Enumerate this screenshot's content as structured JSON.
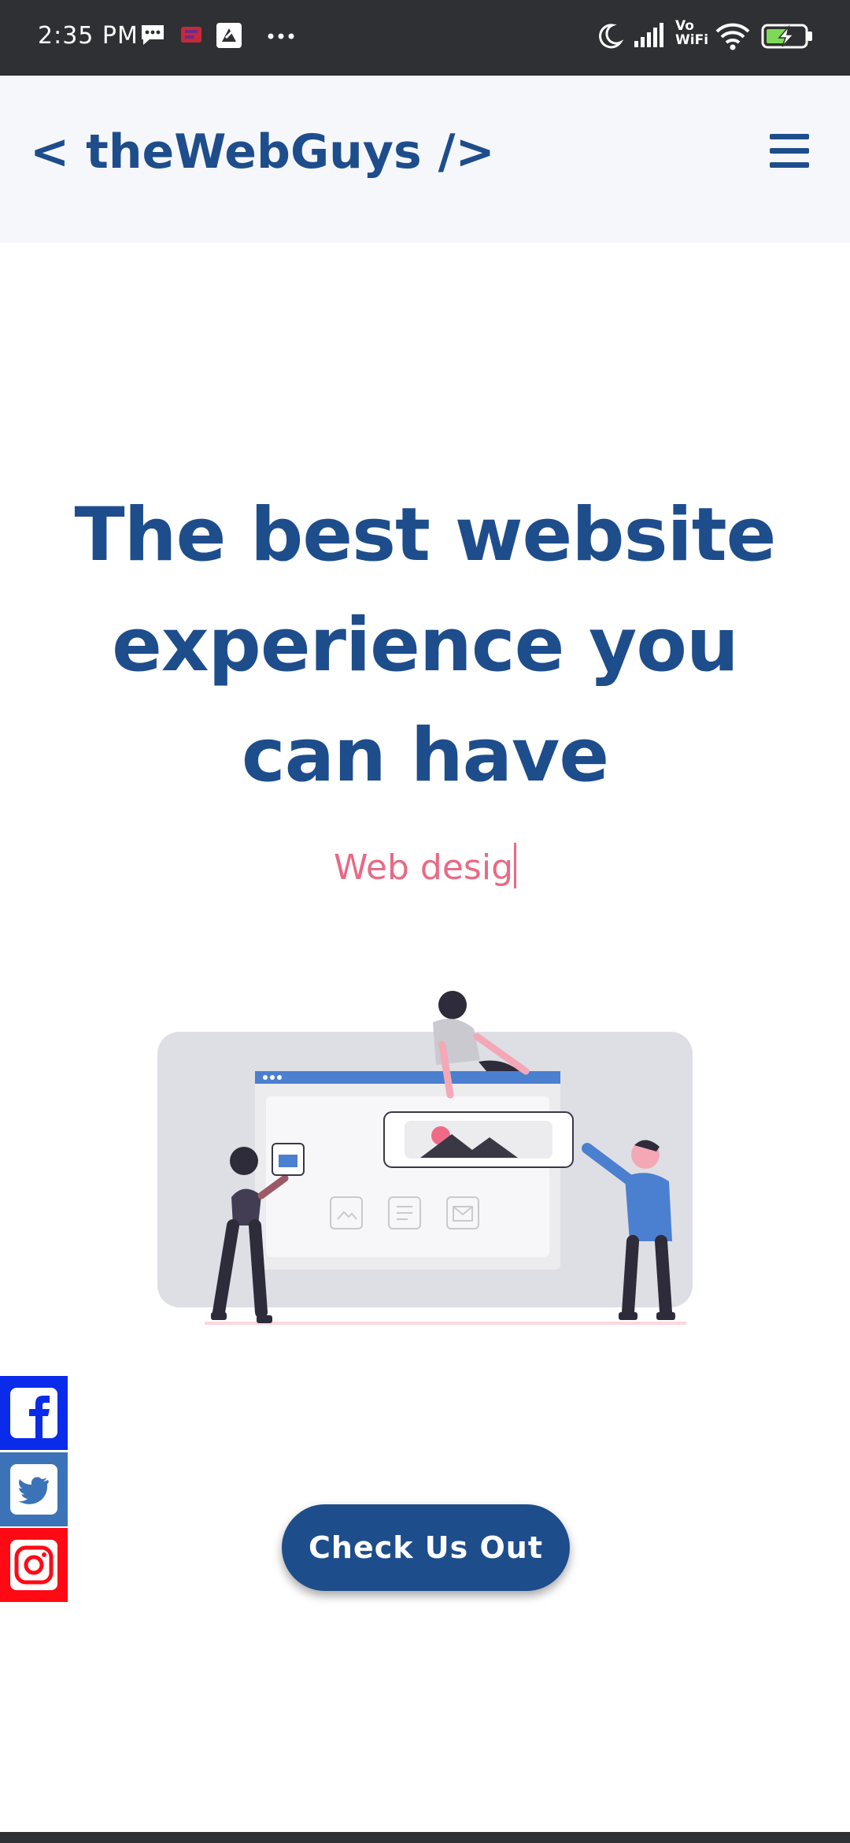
{
  "status_bar": {
    "time": "2:35 PM",
    "icons": [
      "message-icon",
      "notification-icon",
      "notification-icon",
      "more-icon",
      "moon-icon",
      "signal-icon",
      "vowifi-icon",
      "wifi-icon",
      "battery-charging-icon"
    ],
    "vowifi_label_top": "Vo",
    "vowifi_label_bottom": "WiFi"
  },
  "header": {
    "logo": "< theWebGuys />",
    "menu_icon": "hamburger-icon"
  },
  "hero": {
    "title_line1": "The best website",
    "title_line2": "experience you",
    "title_line3": "can have",
    "typing_text": "Web desig"
  },
  "cta": {
    "label": "Check Us Out"
  },
  "social": [
    "facebook-icon",
    "twitter-icon",
    "instagram-icon"
  ],
  "colors": {
    "brand": "#1e4d8c",
    "accent": "#e86a86",
    "status_bar": "#2f3033",
    "header_bg": "#f6f7fa",
    "facebook": "#0b2bea",
    "twitter": "#3c73b8",
    "instagram": "#ff0a14"
  }
}
